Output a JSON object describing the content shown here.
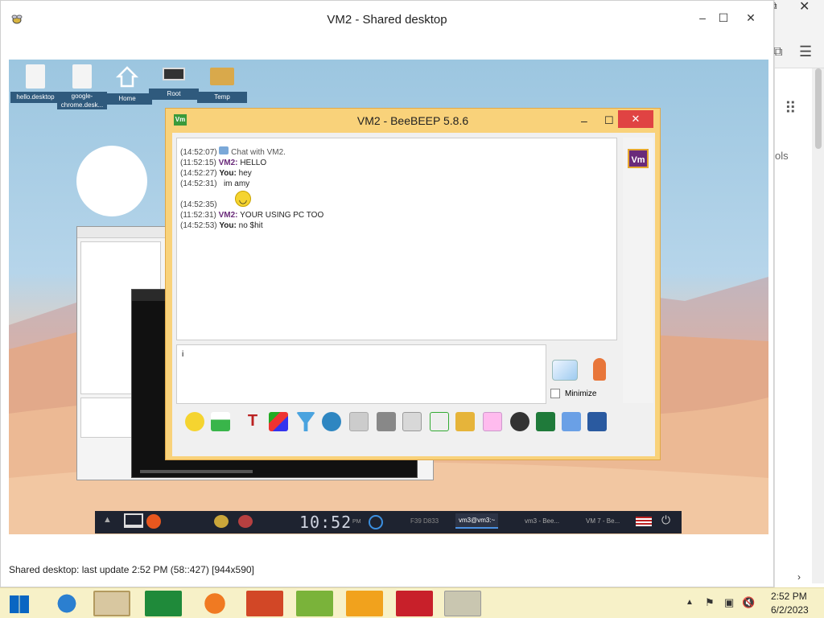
{
  "window": {
    "title": "VM2 - Shared desktop",
    "status": "Shared desktop: last update 2:52 PM (58::427) [944x590]"
  },
  "desktop_icons": [
    {
      "label": "hello.desktop"
    },
    {
      "label": "google-chrome.desk..."
    },
    {
      "label": "Home"
    },
    {
      "label": "Root"
    },
    {
      "label": "Temp"
    }
  ],
  "beebeep": {
    "title": "VM2 - BeeBEEP 5.8.6",
    "badge": "Vm",
    "messages": [
      {
        "time": "(14:52:07)",
        "sender": "",
        "text": "Chat with VM2."
      },
      {
        "time": "(11:52:15)",
        "sender": "VM2:",
        "text": "HELLO"
      },
      {
        "time": "(14:52:27)",
        "sender": "You:",
        "text": "hey"
      },
      {
        "time": "(14:52:31)",
        "sender": "",
        "text": "im amy"
      },
      {
        "time": "(14:52:35)",
        "sender": "",
        "text": ""
      },
      {
        "time": "(11:52:31)",
        "sender": "VM2:",
        "text": "YOUR USING PC TOO"
      },
      {
        "time": "(14:52:53)",
        "sender": "You:",
        "text": "no $hit"
      }
    ],
    "input_value": "i",
    "minimize_label": "Minimize"
  },
  "vm_taskbar": {
    "clock": "10:52",
    "ampm": "PM",
    "tasks": [
      "F39 D833",
      "vm3@vm3:~",
      "vm3 - Bee...",
      "VM 7 - Be..."
    ]
  },
  "win_taskbar": {
    "time": "2:52 PM",
    "date": "6/2/2023"
  },
  "right_strip": {
    "text": "ols"
  }
}
